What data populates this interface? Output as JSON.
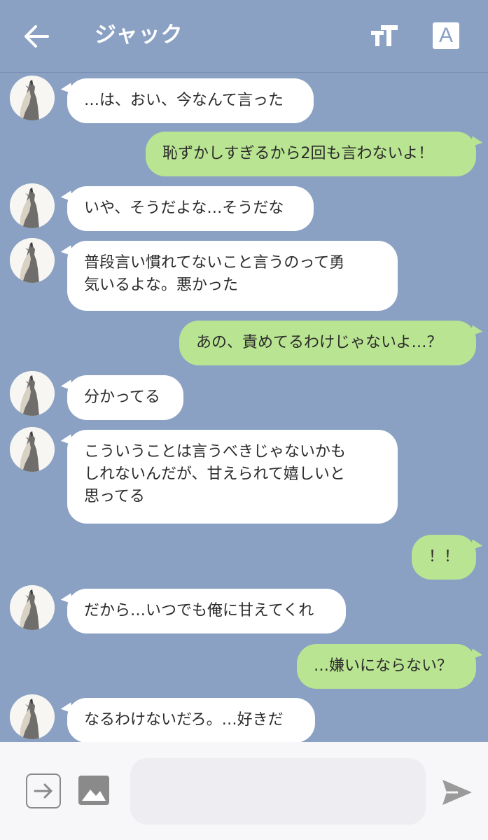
{
  "header": {
    "title": "ジャック",
    "font_button_label": "A"
  },
  "messages": [
    {
      "side": "in",
      "text": "…は、おい、今なんて言った"
    },
    {
      "side": "out",
      "text": "恥ずかしすぎるから2回も言わないよ！"
    },
    {
      "side": "in",
      "text": "いや、そうだよな…そうだな"
    },
    {
      "side": "in",
      "text": "普段言い慣れてないこと言うのって勇\n気いるよな。悪かった"
    },
    {
      "side": "out",
      "text": "あの、責めてるわけじゃないよ…？"
    },
    {
      "side": "in",
      "text": "分かってる"
    },
    {
      "side": "in",
      "text": "こういうことは言うべきじゃないかも\nしれないんだが、甘えられて嬉しいと\n思ってる"
    },
    {
      "side": "out",
      "text": "！！"
    },
    {
      "side": "in",
      "text": "だから…いつでも俺に甘えてくれ"
    },
    {
      "side": "out",
      "text": "…嫌いにならない？"
    },
    {
      "side": "in",
      "text": "なるわけないだろ。…好きだ"
    }
  ],
  "composer": {
    "input_value": "",
    "input_placeholder": ""
  },
  "colors": {
    "background": "#8aa1c4",
    "incoming_bubble": "#ffffff",
    "outgoing_bubble": "#b9e491",
    "composer_bg": "#f7f7f9"
  },
  "icons": [
    "back-arrow-icon",
    "text-size-icon",
    "font-icon",
    "avatar-wolf-icon",
    "share-arrow-icon",
    "image-icon",
    "send-icon"
  ]
}
